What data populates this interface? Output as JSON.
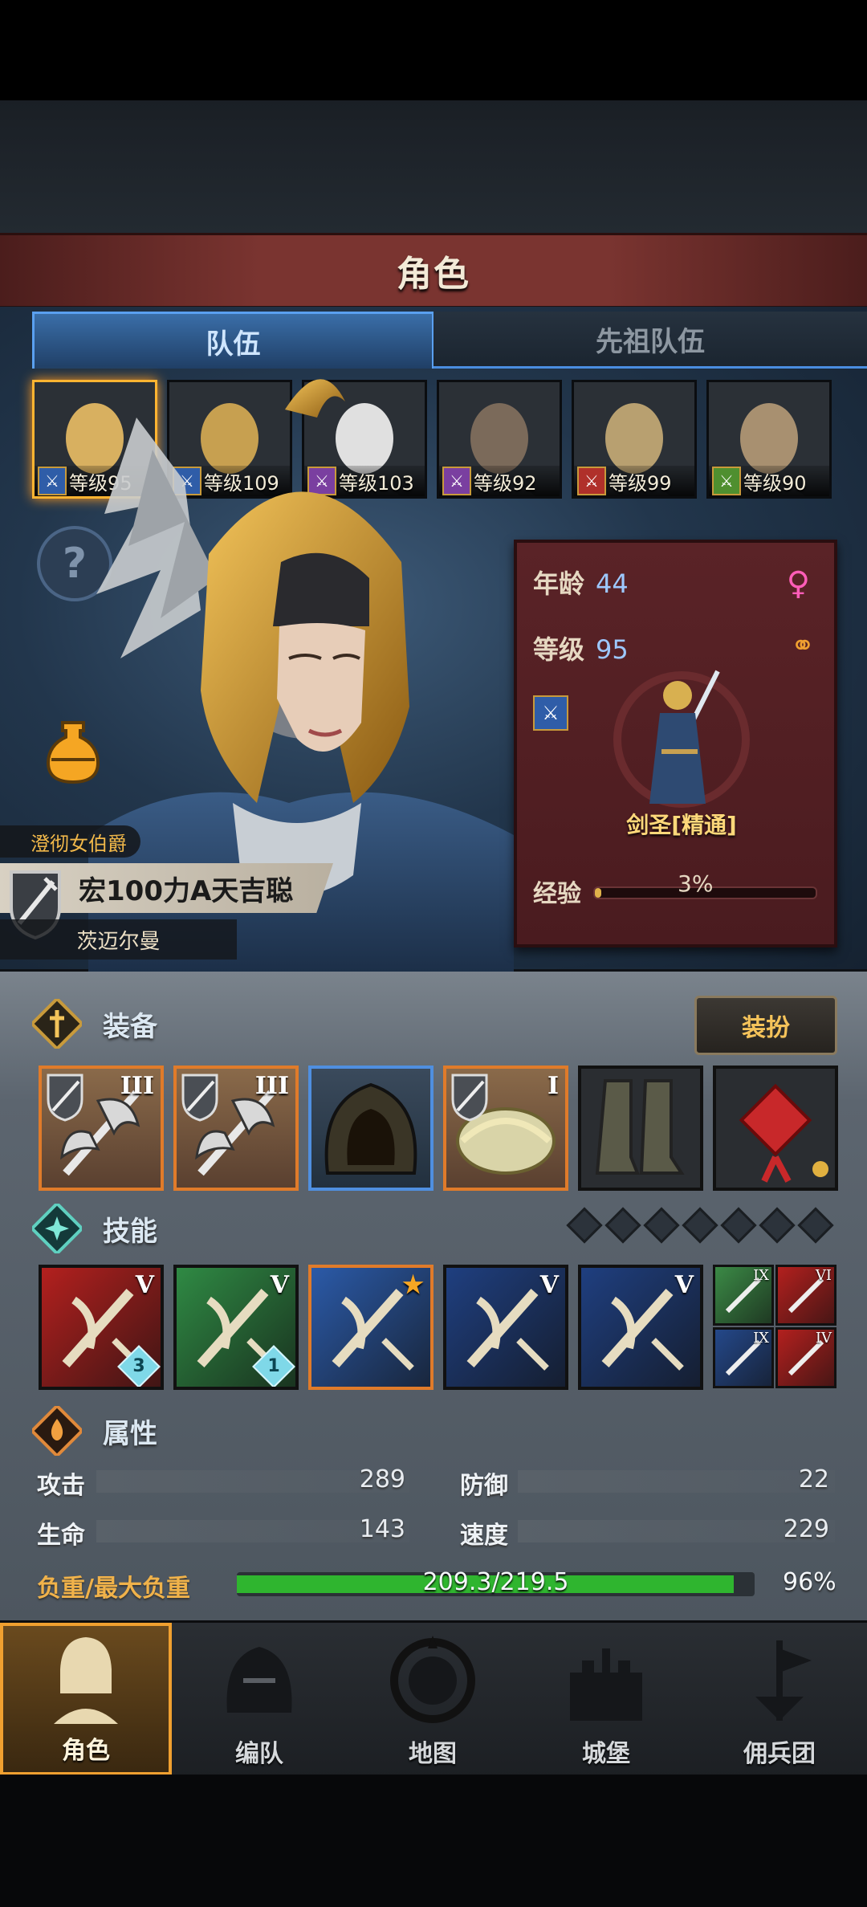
{
  "title": "角色",
  "tabs": [
    {
      "label": "队伍",
      "active": true
    },
    {
      "label": "先祖队伍",
      "active": false
    }
  ],
  "roster": [
    {
      "level": "等级95",
      "class_color": "#2f5da8",
      "selected": true
    },
    {
      "level": "等级109",
      "class_color": "#2f5da8",
      "selected": false
    },
    {
      "level": "等级103",
      "class_color": "#7a3fa0",
      "selected": false
    },
    {
      "level": "等级92",
      "class_color": "#7a3fa0",
      "selected": false
    },
    {
      "level": "等级99",
      "class_color": "#b0302a",
      "selected": false
    },
    {
      "level": "等级90",
      "class_color": "#4f8f2f",
      "selected": false
    }
  ],
  "info": {
    "age_label": "年龄",
    "age": "44",
    "level_label": "等级",
    "level": "95",
    "job": "剑圣[精通]",
    "exp_label": "经验",
    "exp": "3%",
    "exp_fraction": 0.03
  },
  "hero": {
    "title": "澄彻女伯爵",
    "name": "宏100力A天吉聪",
    "origin": "茨迈尔曼"
  },
  "equipment": {
    "header": "装备",
    "costume_button": "装扮",
    "slots": [
      {
        "item": "axe",
        "tier": "III",
        "rarity": "orange"
      },
      {
        "item": "axe",
        "tier": "III",
        "rarity": "orange"
      },
      {
        "item": "hood",
        "tier": "",
        "rarity": "blue"
      },
      {
        "item": "wreath-armor",
        "tier": "I",
        "rarity": "orange"
      },
      {
        "item": "boots",
        "tier": "",
        "rarity": "plain"
      },
      {
        "item": "red-knot-charm",
        "tier": "",
        "rarity": "plain"
      }
    ]
  },
  "skills": {
    "header": "技能",
    "slots": [
      {
        "tier": "V",
        "bg": "#b3201e",
        "badge": "3"
      },
      {
        "tier": "V",
        "bg": "#2f8a44",
        "badge": "1"
      },
      {
        "tier": "",
        "bg": "#2b5aa8",
        "badge": "",
        "star": true
      },
      {
        "tier": "V",
        "bg": "#1f3f80",
        "badge": ""
      },
      {
        "tier": "V",
        "bg": "#1f3f80",
        "badge": ""
      }
    ],
    "mini": [
      {
        "tier": "IX",
        "bg": "#3b8a46"
      },
      {
        "tier": "VI",
        "bg": "#b3201e"
      },
      {
        "tier": "IX",
        "bg": "#24488a"
      },
      {
        "tier": "IV",
        "bg": "#b3201e"
      }
    ]
  },
  "attributes": {
    "header": "属性",
    "attack_label": "攻击",
    "attack": "289",
    "defense_label": "防御",
    "defense": "22",
    "hp_label": "生命",
    "hp": "143",
    "speed_label": "速度",
    "speed": "229",
    "load_label": "负重/最大负重",
    "load": "209.3/219.5",
    "load_pct": "96%",
    "load_fraction": 0.96
  },
  "nav": [
    {
      "label": "角色",
      "icon": "knight-icon",
      "active": true
    },
    {
      "label": "编队",
      "icon": "helmet-icon",
      "active": false
    },
    {
      "label": "地图",
      "icon": "compass-map-icon",
      "active": false
    },
    {
      "label": "城堡",
      "icon": "castle-icon",
      "active": false
    },
    {
      "label": "佣兵团",
      "icon": "mercenary-banner-icon",
      "active": false
    }
  ],
  "colors": {
    "accent_gold": "#f0a030",
    "tab_blue": "#4a8de0",
    "load_green": "#2fb52f"
  }
}
